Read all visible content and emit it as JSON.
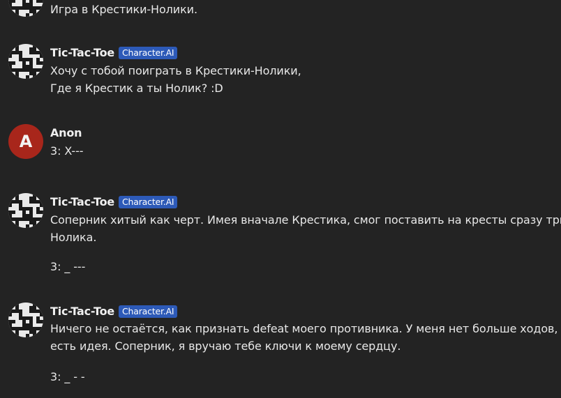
{
  "messages": [
    {
      "author": "",
      "lines": [
        "Игра в Крестики-Нолики."
      ]
    },
    {
      "author": "Tic-Tac-Toe",
      "badge": "Character.AI",
      "lines": [
        "Хочу с тобой поиграть в Крестики-Нолики,",
        "Где я Крестик а ты Нолик? :D"
      ]
    },
    {
      "author": "Anon",
      "avatar_letter": "A",
      "lines": [
        "3: X---"
      ]
    },
    {
      "author": "Tic-Tac-Toe",
      "badge": "Character.AI",
      "lines": [
        "Соперник хитый как черт. Имея вначале Крестика, смог поставить на кресты сразу три",
        "Нолика."
      ],
      "extra": "3: _ ---"
    },
    {
      "author": "Tic-Tac-Toe",
      "badge": "Character.AI",
      "lines": [
        "Ничего не остаётся, как признать defeat моего противника. У меня нет больше ходов, но",
        "есть идея. Соперник, я вручаю тебе ключи к моему сердцу."
      ],
      "extra": "3: _ - -"
    }
  ],
  "colors": {
    "background": "#232323",
    "badge": "#2d5ab8",
    "anon_avatar": "#a8261b"
  },
  "icons": {
    "bot_avatar": "qr-pattern-avatar-icon"
  }
}
